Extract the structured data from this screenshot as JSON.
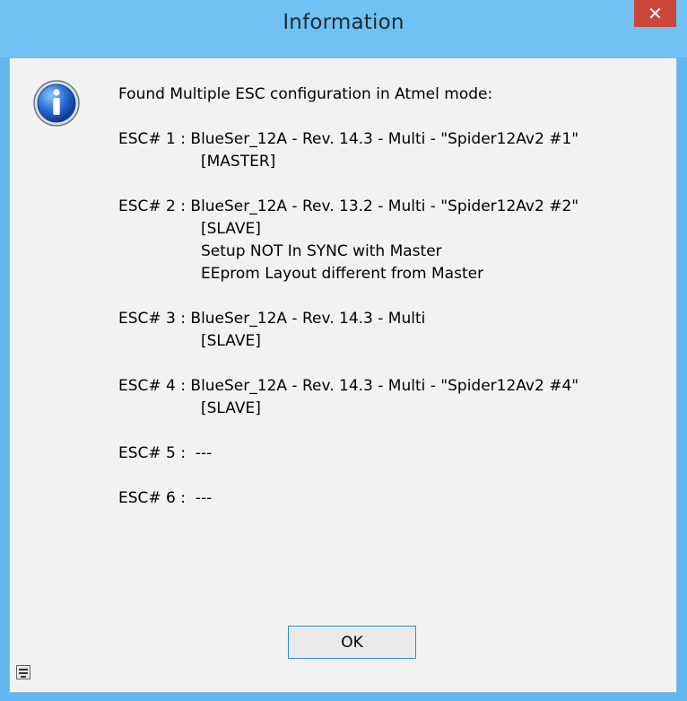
{
  "window": {
    "title": "Information",
    "close_label": "✕",
    "colors": {
      "titlebar": "#6fc2f3",
      "close_button": "#c94638",
      "client_background": "#f2f2f2"
    }
  },
  "icon": {
    "name": "info-icon"
  },
  "message": {
    "header": "Found Multiple ESC configuration in Atmel mode:",
    "esc": [
      {
        "line": "ESC# 1 : BlueSer_12A - Rev. 14.3 - Multi - \"Spider12Av2 #1\"",
        "details": [
          "[MASTER]"
        ]
      },
      {
        "line": "ESC# 2 : BlueSer_12A - Rev. 13.2 - Multi - \"Spider12Av2 #2\"",
        "details": [
          "[SLAVE]",
          "Setup NOT In SYNC with Master",
          "EEprom Layout different from Master"
        ]
      },
      {
        "line": "ESC# 3 : BlueSer_12A - Rev. 14.3 - Multi",
        "details": [
          "[SLAVE]"
        ]
      },
      {
        "line": "ESC# 4 : BlueSer_12A - Rev. 14.3 - Multi - \"Spider12Av2 #4\"",
        "details": [
          "[SLAVE]"
        ]
      },
      {
        "line": "ESC# 5 :  ---",
        "details": []
      },
      {
        "line": "ESC# 6 :  ---",
        "details": []
      }
    ]
  },
  "buttons": {
    "ok_label": "OK"
  },
  "corner": {
    "icon_name": "save-icon"
  }
}
